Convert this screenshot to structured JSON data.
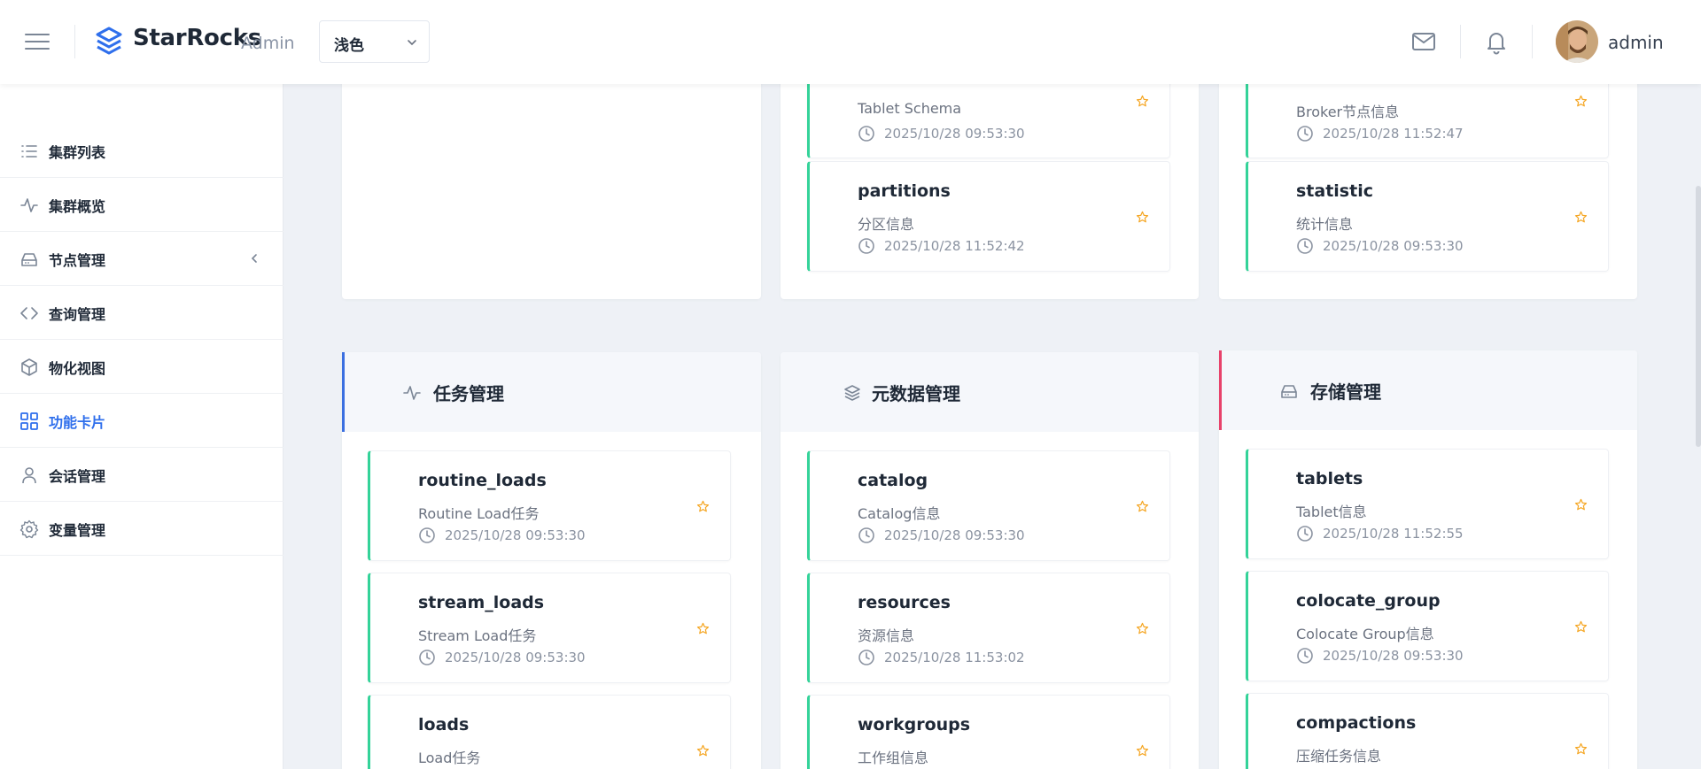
{
  "header": {
    "brand": "StarRocks",
    "brand_sub": "Admin",
    "theme_value": "浅色",
    "username": "admin"
  },
  "sidebar": {
    "items": [
      {
        "label": "集群列表",
        "icon": "list-icon"
      },
      {
        "label": "集群概览",
        "icon": "activity-icon"
      },
      {
        "label": "节点管理",
        "icon": "server-icon"
      },
      {
        "label": "查询管理",
        "icon": "code-icon"
      },
      {
        "label": "物化视图",
        "icon": "cube-icon"
      },
      {
        "label": "功能卡片",
        "icon": "grid-icon"
      },
      {
        "label": "会话管理",
        "icon": "user-icon"
      },
      {
        "label": "变量管理",
        "icon": "gear-icon"
      }
    ],
    "active": "功能卡片"
  },
  "top_cards": {
    "col2": [
      {
        "name": "",
        "desc": "Tablet Schema",
        "time": "2025/10/28 09:53:30"
      },
      {
        "name": "partitions",
        "desc": "分区信息",
        "time": "2025/10/28 11:52:42"
      }
    ],
    "col3": [
      {
        "name": "",
        "desc": "Broker节点信息",
        "time": "2025/10/28 11:52:47"
      },
      {
        "name": "statistic",
        "desc": "统计信息",
        "time": "2025/10/28 09:53:30"
      }
    ]
  },
  "panels": [
    {
      "title": "任务管理",
      "icon": "activity-icon",
      "accent": "#3b6fe0",
      "cards": [
        {
          "name": "routine_loads",
          "desc": "Routine Load任务",
          "time": "2025/10/28 09:53:30"
        },
        {
          "name": "stream_loads",
          "desc": "Stream Load任务",
          "time": "2025/10/28 09:53:30"
        },
        {
          "name": "loads",
          "desc": "Load任务",
          "time": ""
        }
      ]
    },
    {
      "title": "元数据管理",
      "icon": "layers-icon",
      "accent": "",
      "cards": [
        {
          "name": "catalog",
          "desc": "Catalog信息",
          "time": "2025/10/28 09:53:30"
        },
        {
          "name": "resources",
          "desc": "资源信息",
          "time": "2025/10/28 11:53:02"
        },
        {
          "name": "workgroups",
          "desc": "工作组信息",
          "time": ""
        }
      ]
    },
    {
      "title": "存储管理",
      "icon": "hard-drive-icon",
      "accent": "#e8426b",
      "cards": [
        {
          "name": "tablets",
          "desc": "Tablet信息",
          "time": "2025/10/28 11:52:55"
        },
        {
          "name": "colocate_group",
          "desc": "Colocate Group信息",
          "time": "2025/10/28 09:53:30"
        },
        {
          "name": "compactions",
          "desc": "压缩任务信息",
          "time": ""
        }
      ]
    }
  ],
  "colors": {
    "accent": "#2f6fec",
    "card_border": "#34d399",
    "star": "#f5a623"
  }
}
